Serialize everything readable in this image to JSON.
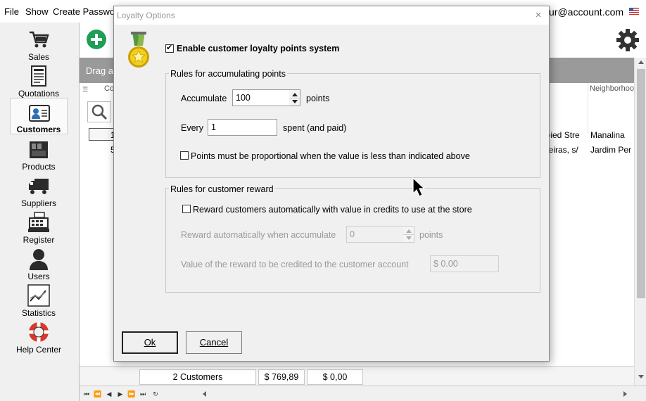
{
  "menubar": {
    "items": [
      "File",
      "Show",
      "Create Password"
    ],
    "account_partial": "ur@account.com"
  },
  "sidebar": {
    "items": [
      {
        "label": "Sales",
        "icon": "cart-icon"
      },
      {
        "label": "Quotations",
        "icon": "document-icon"
      },
      {
        "label": "Customers",
        "icon": "customer-card-icon"
      },
      {
        "label": "Products",
        "icon": "box-icon"
      },
      {
        "label": "Suppliers",
        "icon": "truck-icon"
      },
      {
        "label": "Register",
        "icon": "cash-register-icon"
      },
      {
        "label": "Users",
        "icon": "user-icon"
      },
      {
        "label": "Statistics",
        "icon": "chart-icon"
      },
      {
        "label": "Help Center",
        "icon": "lifebuoy-icon"
      }
    ],
    "active": "Customers"
  },
  "main": {
    "group_panel_partial": "Drag a",
    "col_header_code": "Co",
    "col_header_neighborhood": "Neighborhoo",
    "rows": [
      {
        "code": "1",
        "street": "ipied Stre",
        "neighborhood": "Manalina"
      },
      {
        "code": "5",
        "street": "beiras, s/",
        "neighborhood": "Jardim Per"
      }
    ],
    "footer": {
      "count": "2 Customers",
      "total": "$ 769,89",
      "credit": "$ 0,00"
    }
  },
  "dialog": {
    "title": "Loyalty Options",
    "close": "×",
    "enable_label": "Enable customer loyalty points system",
    "enable_checked": true,
    "accumulating": {
      "title": "Rules for accumulating points",
      "accumulate_label": "Accumulate",
      "accumulate_value": "100",
      "points_label": "points",
      "every_label": "Every",
      "every_value": "1",
      "spent_label": "spent (and paid)",
      "proportional_label": "Points must be proportional when the value is less than indicated above",
      "proportional_checked": false
    },
    "reward": {
      "title": "Rules for customer reward",
      "auto_label": "Reward customers automatically with value in credits to use at the store",
      "auto_checked": false,
      "when_label": "Reward automatically when accumulate",
      "when_value": "0",
      "points_label": "points",
      "value_label": "Value of the reward to be credited to the customer account",
      "value_value": "$ 0.00"
    },
    "ok_label": "Ok",
    "cancel_label": "Cancel"
  },
  "colors": {
    "accent_green": "#1f9e55",
    "group_panel": "#9a9a9a",
    "disabled_text": "#9a9a9a"
  }
}
